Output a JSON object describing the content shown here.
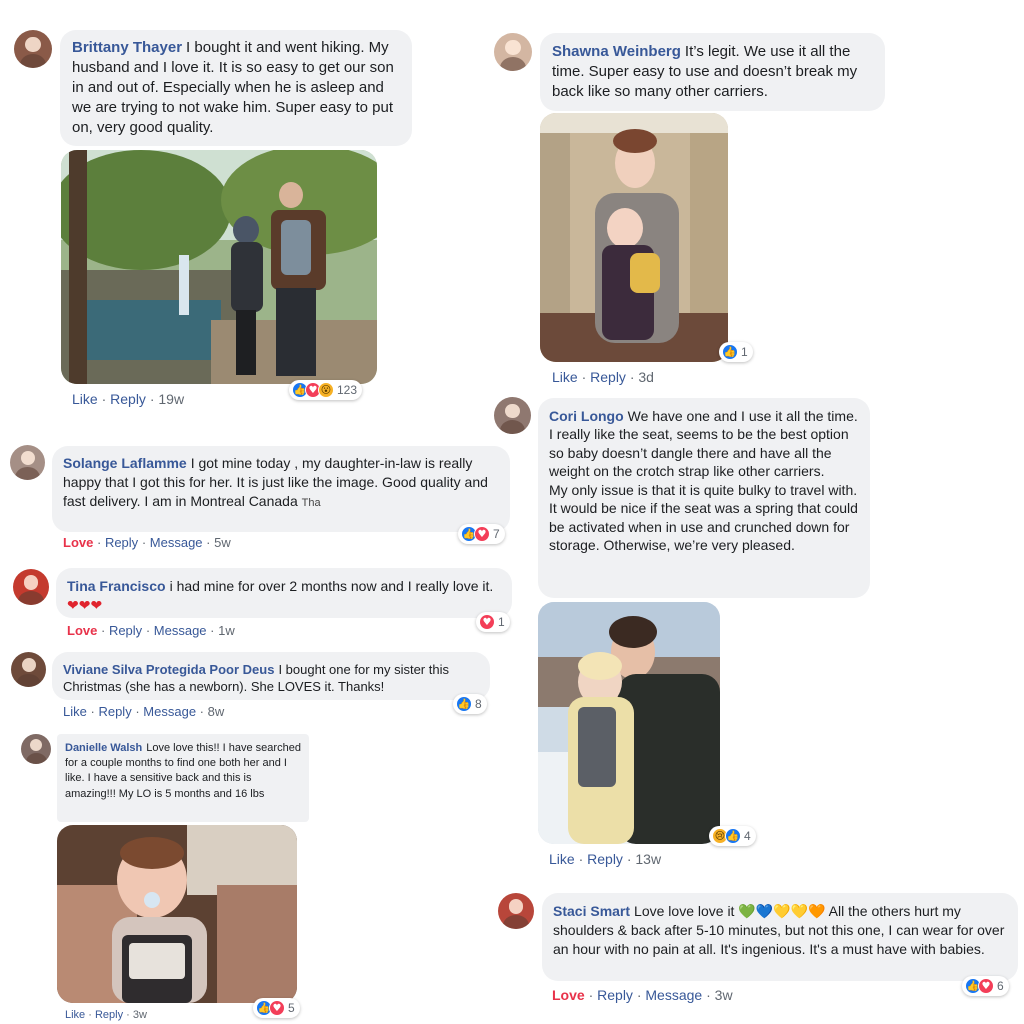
{
  "comments": [
    {
      "author": "Brittany Thayer",
      "text": "I bought it and went hiking. My husband and I love it. It is so easy to get our son in and out of. Especially when he is asleep and we are trying to not wake him. Super easy to put on, very good quality.",
      "actions": {
        "a": "Like",
        "b": "Reply",
        "time": "19w"
      },
      "reactions": {
        "count": "123",
        "icons": [
          "like-icon",
          "love-icon",
          "wow-icon"
        ]
      },
      "photo": "couple-hiking-waterfall-photo"
    },
    {
      "author": "Solange Laflamme",
      "text": "I got mine today , my daughter-in-law is really happy that I got this for her. It is just like the image. Good quality and fast delivery. I am in Montreal Canada",
      "suffix": "Tha",
      "actions": {
        "a": "Love",
        "b": "Reply",
        "c": "Message",
        "time": "5w"
      },
      "reactions": {
        "count": "7",
        "icons": [
          "like-icon",
          "love-icon"
        ]
      }
    },
    {
      "author": "Tina Francisco",
      "text": "i had mine for over 2 months now and I really love it.",
      "hearts": "❤❤❤",
      "actions": {
        "a": "Love",
        "b": "Reply",
        "c": "Message",
        "time": "1w"
      },
      "reactions": {
        "count": "1",
        "icons": [
          "love-icon"
        ]
      }
    },
    {
      "author": "Viviane Silva Protegida Poor Deus",
      "text": "I bought one for my sister this Christmas (she has a newborn). She LOVES it. Thanks!",
      "actions": {
        "a": "Like",
        "b": "Reply",
        "c": "Message",
        "time": "8w"
      },
      "reactions": {
        "count": "8",
        "icons": [
          "like-icon"
        ]
      }
    },
    {
      "author": "Danielle Walsh",
      "text": "Love love this!! I have searched for a couple months to find one both her and I like. I have a sensitive back and this is amazing!!! My LO is 5 months and 16 lbs",
      "actions": {
        "a": "Like",
        "b": "Reply",
        "time": "3w"
      },
      "reactions": {
        "count": "5",
        "icons": [
          "like-icon",
          "love-icon"
        ]
      },
      "photo": "baby-with-pacifier-in-carrier-photo"
    },
    {
      "author": "Shawna Weinberg",
      "text": "It’s legit. We use it all the time. Super easy to use and doesn’t break my back like so many other carriers.",
      "actions": {
        "a": "Like",
        "b": "Reply",
        "time": "3d"
      },
      "reactions": {
        "count": "1",
        "icons": [
          "like-icon"
        ]
      },
      "photo": "mother-baby-hallway-photo"
    },
    {
      "author": "Cori Longo",
      "text": "We have one and I use it all the time. I really like the seat, seems to be the best option so baby doesn’t dangle there and have all the weight on the crotch strap like other carriers.\nMy only issue is that it is quite bulky to travel with. It would be nice if the seat was a spring that could be activated when in use and crunched down for storage. Otherwise, we’re very pleased.",
      "actions": {
        "a": "Like",
        "b": "Reply",
        "time": "13w"
      },
      "reactions": {
        "count": "4",
        "icons": [
          "sad-icon",
          "like-icon"
        ]
      },
      "photo": "mother-baby-snow-photo"
    },
    {
      "author": "Staci Smart",
      "text": "Love love love it",
      "emoji": "💚💙💛💛🧡",
      "text2": "All the others hurt my shoulders & back after 5-10 minutes, but not this one, I can wear for over an hour with no pain at all. It's ingenious. It's a must have with babies.",
      "actions": {
        "a": "Love",
        "b": "Reply",
        "c": "Message",
        "time": "3w"
      },
      "reactions": {
        "count": "6",
        "icons": [
          "like-icon",
          "love-icon"
        ]
      }
    }
  ],
  "separators": {
    "dot": "·"
  },
  "icons": {
    "like": "👍",
    "love": "♥",
    "wow": "😮",
    "sad": "😢"
  }
}
